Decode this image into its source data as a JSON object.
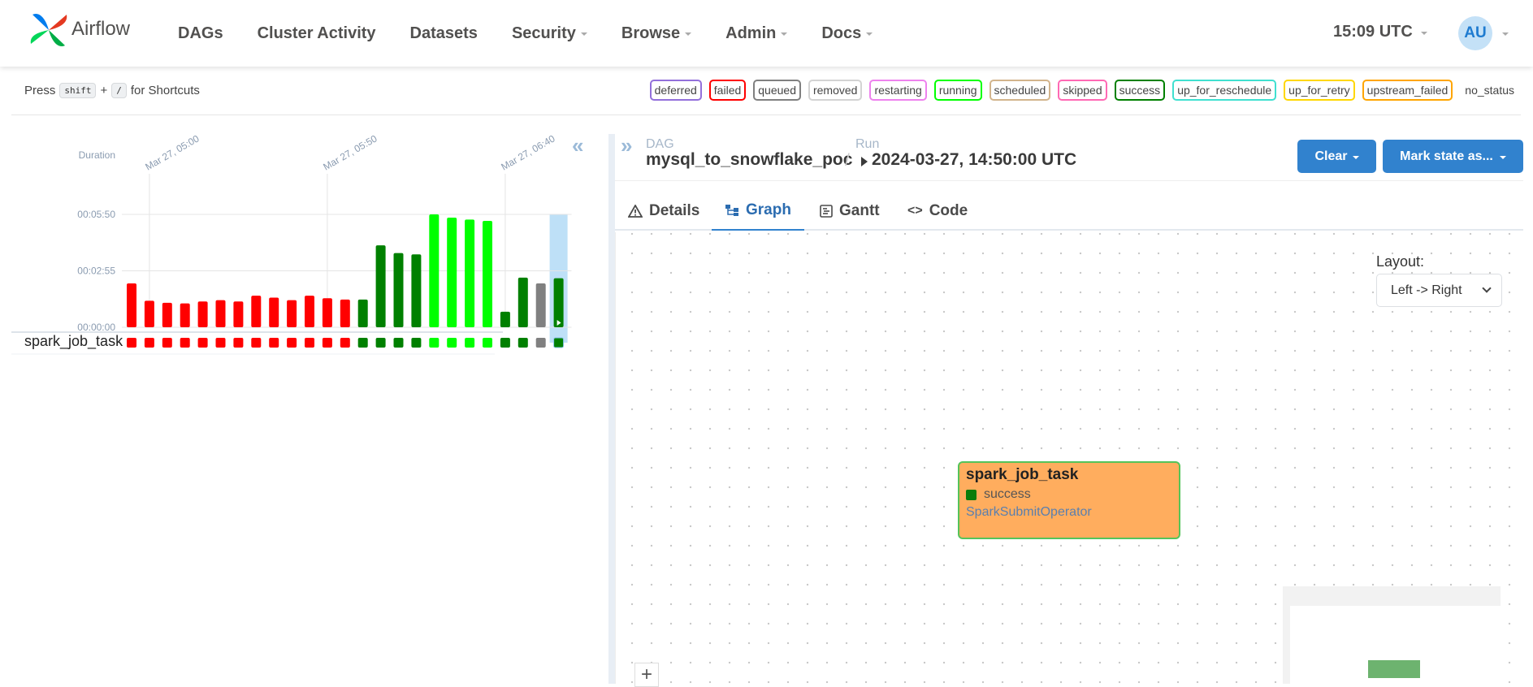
{
  "nav": {
    "brand": "Airflow",
    "items": [
      {
        "label": "DAGs",
        "dropdown": false
      },
      {
        "label": "Cluster Activity",
        "dropdown": false
      },
      {
        "label": "Datasets",
        "dropdown": false
      },
      {
        "label": "Security",
        "dropdown": true
      },
      {
        "label": "Browse",
        "dropdown": true
      },
      {
        "label": "Admin",
        "dropdown": true
      },
      {
        "label": "Docs",
        "dropdown": true
      }
    ],
    "clock": "15:09 UTC",
    "avatar": "AU"
  },
  "shortcuts": {
    "press": "Press",
    "key1": "shift",
    "plus": "+",
    "key2": "/",
    "suffix": "for Shortcuts"
  },
  "statuses": [
    {
      "label": "deferred",
      "color": "#9370db"
    },
    {
      "label": "failed",
      "color": "#ff0000"
    },
    {
      "label": "queued",
      "color": "#808080"
    },
    {
      "label": "removed",
      "color": "#d3d3d3"
    },
    {
      "label": "restarting",
      "color": "#ee82ee"
    },
    {
      "label": "running",
      "color": "#00ff00"
    },
    {
      "label": "scheduled",
      "color": "#d2b48c"
    },
    {
      "label": "skipped",
      "color": "#ff69b4"
    },
    {
      "label": "success",
      "color": "#008000"
    },
    {
      "label": "up_for_reschedule",
      "color": "#40e0d0"
    },
    {
      "label": "up_for_retry",
      "color": "#ffd700"
    },
    {
      "label": "upstream_failed",
      "color": "#ffa500"
    },
    {
      "label": "no_status",
      "color": ""
    }
  ],
  "chart_data": {
    "type": "bar",
    "ylabel": "Duration",
    "yticks": [
      "00:00:00",
      "00:02:55",
      "00:05:50"
    ],
    "ylim_seconds": [
      0,
      350
    ],
    "xticks": [
      "Mar 27, 05:00",
      "Mar 27, 05:50",
      "Mar 27, 06:40"
    ],
    "xtick_run_index": [
      1,
      11,
      21
    ],
    "values_seconds": [
      136,
      82,
      76,
      74,
      80,
      84,
      80,
      98,
      92,
      84,
      98,
      90,
      86,
      86,
      254,
      230,
      226,
      350,
      340,
      334,
      330,
      48,
      154,
      136,
      152
    ],
    "states": [
      "failed",
      "failed",
      "failed",
      "failed",
      "failed",
      "failed",
      "failed",
      "failed",
      "failed",
      "failed",
      "failed",
      "failed",
      "failed",
      "success",
      "success",
      "success",
      "success",
      "running",
      "running",
      "running",
      "running",
      "success",
      "success",
      "queued",
      "success"
    ],
    "colors": {
      "failed": "#ff0000",
      "success": "#008000",
      "running": "#00ff00",
      "queued": "#808080"
    },
    "selected_index": 24
  },
  "grid": {
    "task_name": "spark_job_task",
    "collapse_icon": "«",
    "expand_icon": "»"
  },
  "breadcrumb": {
    "dag_label": "DAG",
    "dag_id": "mysql_to_snowflake_poc",
    "sep": "/",
    "run_label": "Run",
    "run_id": "2024-03-27, 14:50:00 UTC"
  },
  "actions": {
    "clear": "Clear",
    "mark_state": "Mark state as..."
  },
  "tabs": [
    {
      "label": "Details",
      "icon": "warning-icon",
      "active": false
    },
    {
      "label": "Graph",
      "icon": "graph-icon",
      "active": true
    },
    {
      "label": "Gantt",
      "icon": "gantt-icon",
      "active": false
    },
    {
      "label": "Code",
      "icon": "code-icon",
      "active": false
    }
  ],
  "layout": {
    "label": "Layout:",
    "value": "Left -> Right"
  },
  "node": {
    "title": "spark_job_task",
    "state": "success",
    "operator": "SparkSubmitOperator",
    "fill": "#ffad5e",
    "border": "#55c45a"
  },
  "zoom": {
    "plus": "+"
  }
}
